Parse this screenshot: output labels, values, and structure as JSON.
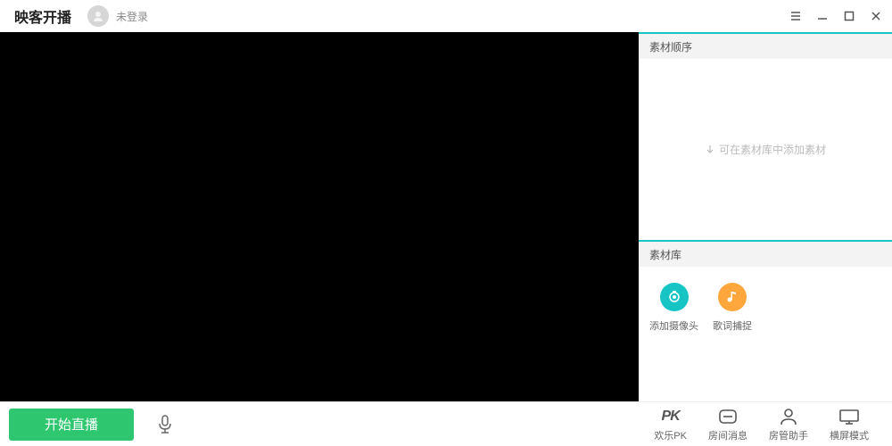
{
  "header": {
    "app_title": "映客开播",
    "login_status": "未登录"
  },
  "sidebar": {
    "order_panel": {
      "title": "素材顺序",
      "empty_hint": "可在素材库中添加素材"
    },
    "library_panel": {
      "title": "素材库",
      "items": [
        {
          "label": "添加摄像头",
          "icon": "camera"
        },
        {
          "label": "歌词捕捉",
          "icon": "lyrics"
        }
      ]
    }
  },
  "bottom": {
    "start_label": "开始直播",
    "tools": [
      {
        "label": "欢乐PK",
        "icon": "pk"
      },
      {
        "label": "房间消息",
        "icon": "message"
      },
      {
        "label": "房管助手",
        "icon": "admin"
      },
      {
        "label": "横屏模式",
        "icon": "landscape"
      }
    ]
  }
}
